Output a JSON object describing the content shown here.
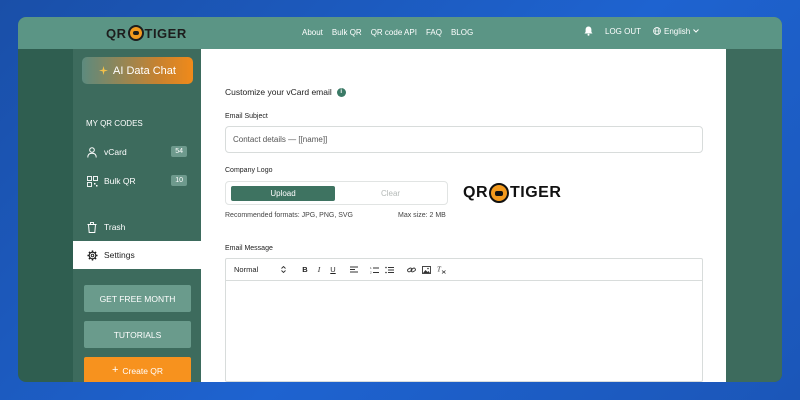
{
  "header": {
    "brand_left": "QR",
    "brand_right": "TIGER",
    "nav": [
      "About",
      "Bulk QR",
      "QR code API",
      "FAQ",
      "BLOG"
    ],
    "logout": "LOG OUT",
    "language": "English"
  },
  "sidebar": {
    "ai_button": "AI Data Chat",
    "section_title": "MY QR CODES",
    "items": [
      {
        "label": "vCard",
        "count": "54"
      },
      {
        "label": "Bulk QR",
        "count": "10"
      },
      {
        "label": "Trash"
      },
      {
        "label": "Settings"
      }
    ],
    "get_free_month": "GET FREE MONTH",
    "tutorials": "TUTORIALS",
    "create_qr": "Create QR"
  },
  "content": {
    "title": "Customize your vCard email",
    "email_subject_label": "Email Subject",
    "email_subject_value": "Contact details — [[name]]",
    "company_logo_label": "Company Logo",
    "upload": "Upload",
    "clear": "Clear",
    "formats_hint": "Recommended formats: JPG, PNG, SVG",
    "max_size": "Max size: 2 MB",
    "email_message_label": "Email Message",
    "editor": {
      "format_select": "Normal",
      "bold": "B",
      "italic": "I",
      "underline": "U"
    }
  },
  "colors": {
    "topbar": "#5b9585",
    "sidebar": "#3d6b5d",
    "accent_green": "#3e7361",
    "accent_orange": "#f7921e"
  }
}
